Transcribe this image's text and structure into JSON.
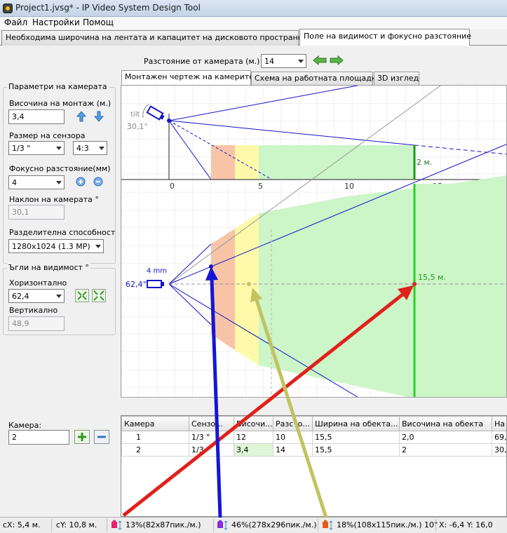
{
  "window": {
    "title": "Project1.jvsg* - IP Video System Design Tool"
  },
  "menu": [
    "Файл",
    "Настройки",
    "Помощ"
  ],
  "main_tabs": [
    "Необходима широчина на лентата и капацитет на дисковото пространство",
    "Поле на видимост и фокусно разстояние"
  ],
  "distance": {
    "label": "Разстояние от камерата (м.)",
    "value": "14"
  },
  "sub_tabs": [
    "Монтажен чертеж на камерите",
    "Схема на работната площадка",
    "3D изглед"
  ],
  "camera_params": {
    "group_title": "Параметри на камерата",
    "mount_height_label": "Височина на монтаж (м.)",
    "mount_height_value": "3,4",
    "sensor_label": "Размер на сензора",
    "sensor_value": "1/3 \"",
    "aspect_value": "4:3",
    "focal_label": "Фокусно разстояние(мм)",
    "focal_value": "4",
    "tilt_label": "Наклон на камерата °",
    "tilt_value": "30,1",
    "resolution_label": "Разделителна способност",
    "resolution_value": "1280x1024 (1.3 MP)"
  },
  "fov": {
    "group_title": "Ъгли на видимост °",
    "horizontal_label": "Хоризонтално",
    "horizontal_value": "62,4",
    "vertical_label": "Вертикално",
    "vertical_value": "48,9"
  },
  "drawing": {
    "side": {
      "tilt_label": "tilt",
      "angle_label": "30,1°",
      "height_label": "2 м.",
      "ticks": [
        "0",
        "5",
        "10",
        "15"
      ]
    },
    "top": {
      "focal_label": "4 mm",
      "angle_label": "62,4°",
      "width_label": "15,5 м."
    }
  },
  "camera_select": {
    "label": "Камера:",
    "value": "2"
  },
  "table": {
    "headers": [
      "Камера",
      "Сензо...",
      "Височи...",
      "Разсто...",
      "Ширина на обекта...",
      "Височина на обекта",
      "На"
    ],
    "rows": [
      [
        "1",
        "1/3 \"",
        "12",
        "10",
        "15,5",
        "2,0",
        "69,"
      ],
      [
        "2",
        "1/3 \"",
        "3,4",
        "14",
        "15,5",
        "2",
        "30,"
      ]
    ]
  },
  "status": {
    "cx": "cX: 5,4 м.",
    "cy": "cY: 10,8 м.",
    "zone1": "13%(82x87пик./м.)",
    "zone2": "46%(278x296пик./м.)",
    "zone3": "18%(108x115пик./м.) 10°",
    "coords": "X: -6,4 Y: 16,0"
  },
  "colors": {
    "zone_red": "#f8c4a8",
    "zone_yellow": "#fdf9a8",
    "zone_green": "#ccf5c8",
    "arrow_red": "#e0211c",
    "arrow_blue": "#1515d6",
    "arrow_olive": "#c2c260",
    "camera_blue": "#1414c8"
  },
  "icons": [
    "up-arrow-icon",
    "down-arrow-icon",
    "plus-icon",
    "minus-icon",
    "green-back-arrow-icon",
    "green-forward-arrow-icon",
    "fov-expand-icon",
    "fov-shrink-icon",
    "camera-icon",
    "person-icon"
  ]
}
